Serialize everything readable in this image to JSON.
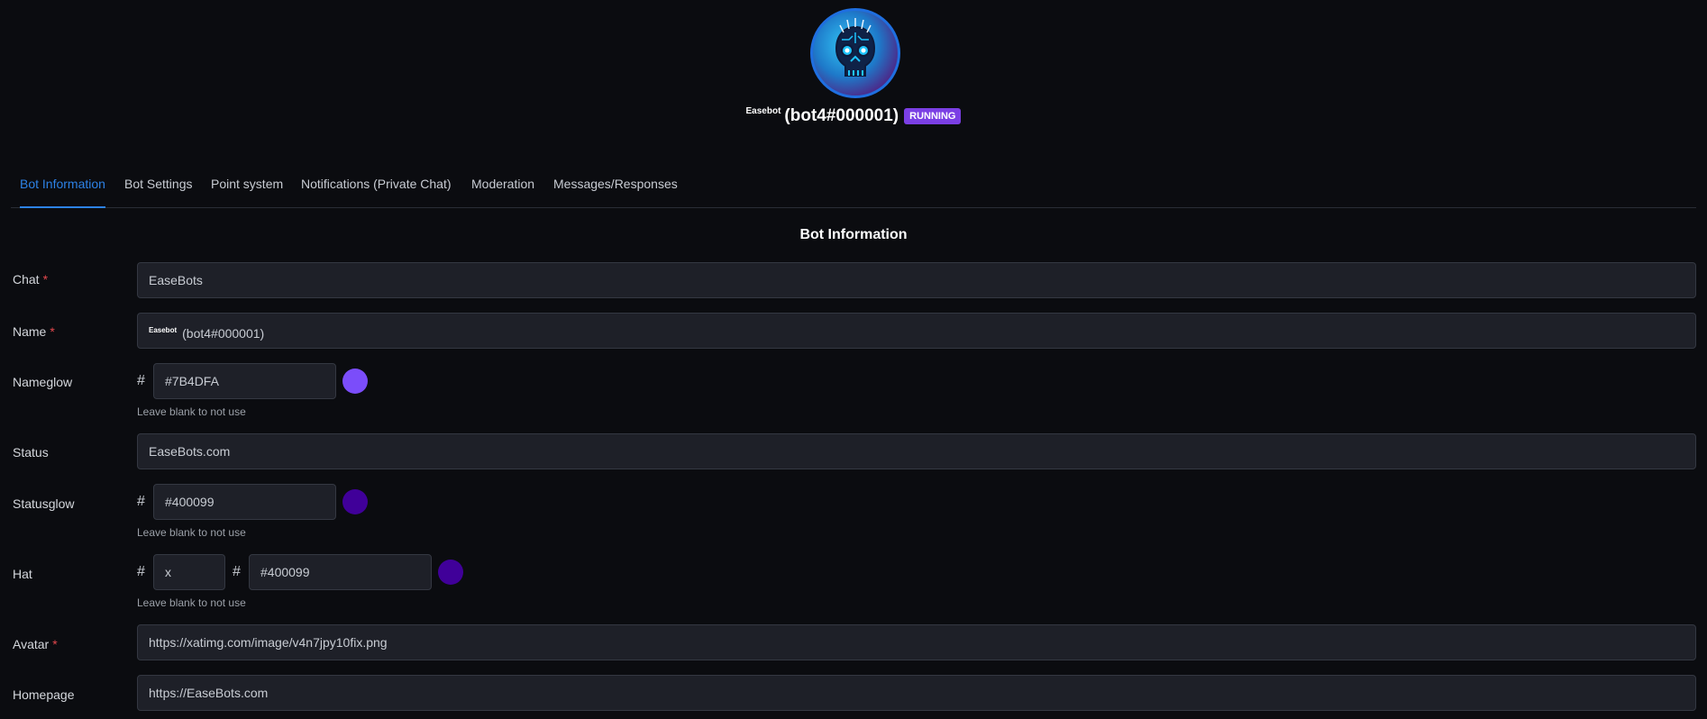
{
  "header": {
    "bot_small_name": "Easebot",
    "bot_id": "(bot4#000001)",
    "status_badge": "RUNNING"
  },
  "tabs": [
    {
      "label": "Bot Information",
      "active": true
    },
    {
      "label": "Bot Settings"
    },
    {
      "label": "Point system"
    },
    {
      "label": "Notifications (Private Chat)"
    },
    {
      "label": "Moderation"
    },
    {
      "label": "Messages/Responses"
    }
  ],
  "section_title": "Bot Information",
  "form": {
    "chat": {
      "label": "Chat",
      "required": "*",
      "value": "EaseBots"
    },
    "name": {
      "label": "Name",
      "required": "*",
      "small": "Easebot",
      "value": "(bot4#000001)"
    },
    "nameglow": {
      "label": "Nameglow",
      "hash": "#",
      "value": "#7B4DFA",
      "color": "#7b4dfa",
      "help": "Leave blank to not use"
    },
    "status": {
      "label": "Status",
      "value": "EaseBots.com"
    },
    "statusglow": {
      "label": "Statusglow",
      "hash": "#",
      "value": "#400099",
      "color": "#400099",
      "help": "Leave blank to not use"
    },
    "hat": {
      "label": "Hat",
      "hash": "#",
      "value": "x",
      "hash2": "#",
      "color_value": "#400099",
      "color": "#400099",
      "help": "Leave blank to not use"
    },
    "avatar": {
      "label": "Avatar",
      "required": "*",
      "value": "https://xatimg.com/image/v4n7jpy10fix.png"
    },
    "homepage": {
      "label": "Homepage",
      "value": "https://EaseBots.com"
    }
  }
}
